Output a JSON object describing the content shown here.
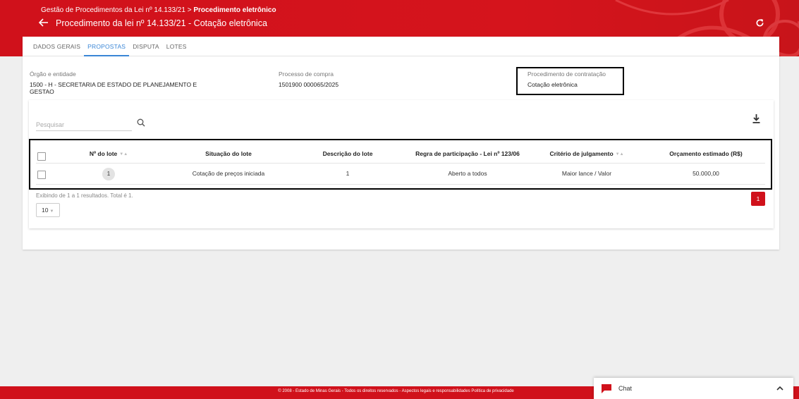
{
  "header": {
    "breadcrumb_parent": "Gestão de Procedimentos da Lei nº 14.133/21",
    "breadcrumb_separator": ">",
    "breadcrumb_current": "Procedimento eletrônico",
    "title": "Procedimento da lei nº 14.133/21 - Cotação eletrônica",
    "back_icon": "arrow-left-icon",
    "refresh_icon": "refresh-icon"
  },
  "tabs": [
    {
      "label": "DADOS GERAIS",
      "active": false
    },
    {
      "label": "PROPOSTAS",
      "active": true
    },
    {
      "label": "DISPUTA",
      "active": false
    },
    {
      "label": "LOTES",
      "active": false
    }
  ],
  "info": {
    "orgao_label": "Órgão e entidade",
    "orgao_value": "1500 - H - SECRETARIA DE ESTADO DE PLANEJAMENTO E GESTAO",
    "processo_label": "Processo de compra",
    "processo_value": "1501900 000065/2025",
    "procedimento_label": "Procedimento de contratação",
    "procedimento_value": "Cotação eletrônica"
  },
  "search": {
    "placeholder": "Pesquisar",
    "value": ""
  },
  "table": {
    "columns": [
      "Nº do lote",
      "Situação do lote",
      "Descrição do lote",
      "Regra de participação - Lei nº 123/06",
      "Critério de julgamento",
      "Orçamento estimado (R$)"
    ],
    "rows": [
      {
        "lote": "1",
        "situacao": "Cotação de preços iniciada",
        "descricao": "1",
        "regra": "Aberto a todos",
        "criterio": "Maior lance / Valor",
        "orcamento": "50.000,00"
      }
    ]
  },
  "pagination": {
    "results_text": "Exibindo de 1 a 1 resultados. Total é 1.",
    "page_size": "10",
    "current_page": "1"
  },
  "footer": {
    "text": "© 2008 - Estado de Minas Gerais - Todos os direitos reservados - Aspectos legais e responsabilidades Política de privacidade"
  },
  "chat": {
    "label": "Chat"
  },
  "colors": {
    "brand_red": "#d0111b",
    "tab_active": "#3a86d6"
  }
}
